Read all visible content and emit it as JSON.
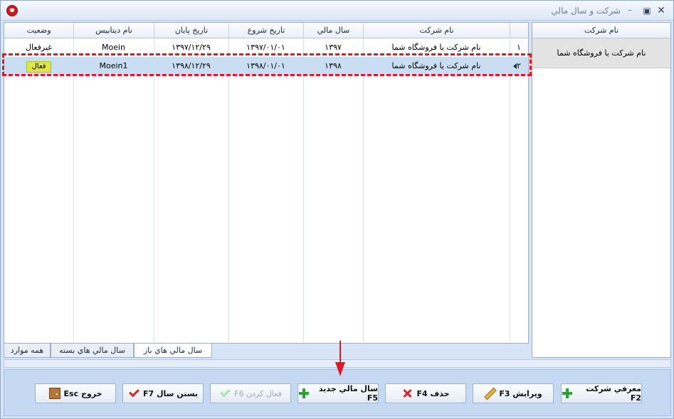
{
  "window": {
    "title": "شرکت و سال مالي",
    "title_separator": "–",
    "restore_symbol": "▣",
    "close_symbol": "✕"
  },
  "grid": {
    "columns": [
      "",
      "نام شرکت",
      "سال مالي",
      "تاريخ شروع",
      "تاريخ پايان",
      "نام ديتابيس",
      "وضعيت"
    ],
    "rows": [
      {
        "num": "۱",
        "company": "نام شرکت يا فروشگاه شما",
        "year": "۱۳۹۷",
        "start": "۱۳۹۷/۰۱/۰۱",
        "end": "۱۳۹۷/۱۲/۲۹",
        "db": "Moein",
        "status": "غيرفعال",
        "selected": false
      },
      {
        "num": "۲",
        "company": "نام شرکت يا فروشگاه شما",
        "year": "۱۳۹۸",
        "start": "۱۳۹۸/۰۱/۰۱",
        "end": "۱۳۹۸/۱۲/۲۹",
        "db": "Moein1",
        "status": "فعال",
        "selected": true
      }
    ]
  },
  "tabs": [
    {
      "label": "سال مالي هاي باز",
      "active": true
    },
    {
      "label": "سال مالي هاي بسته",
      "active": false
    },
    {
      "label": "همه موارد",
      "active": false
    }
  ],
  "side_panel": {
    "header": "نام شرکت",
    "items": [
      "نام شرکت يا فروشگاه شما"
    ]
  },
  "buttons": [
    {
      "label": "معرفي شرکت F2",
      "icon": "plus-icon",
      "enabled": true
    },
    {
      "label": "ويرايش F3",
      "icon": "pencil-icon",
      "enabled": true
    },
    {
      "label": "حذف F4",
      "icon": "x-icon",
      "enabled": true
    },
    {
      "label": "سال مالي جديد F5",
      "icon": "plus-icon",
      "enabled": true
    },
    {
      "label": "فعال کردن F6",
      "icon": "check-icon",
      "enabled": false
    },
    {
      "label": "بستن سال F7",
      "icon": "check-icon",
      "enabled": true
    },
    {
      "label": "خروج Esc",
      "icon": "door-icon",
      "enabled": true
    }
  ],
  "colors": {
    "highlight_border": "#e0182a",
    "selected_row": "#c9ddf3",
    "active_badge": "#dde54a",
    "arrow": "#e0182a"
  }
}
